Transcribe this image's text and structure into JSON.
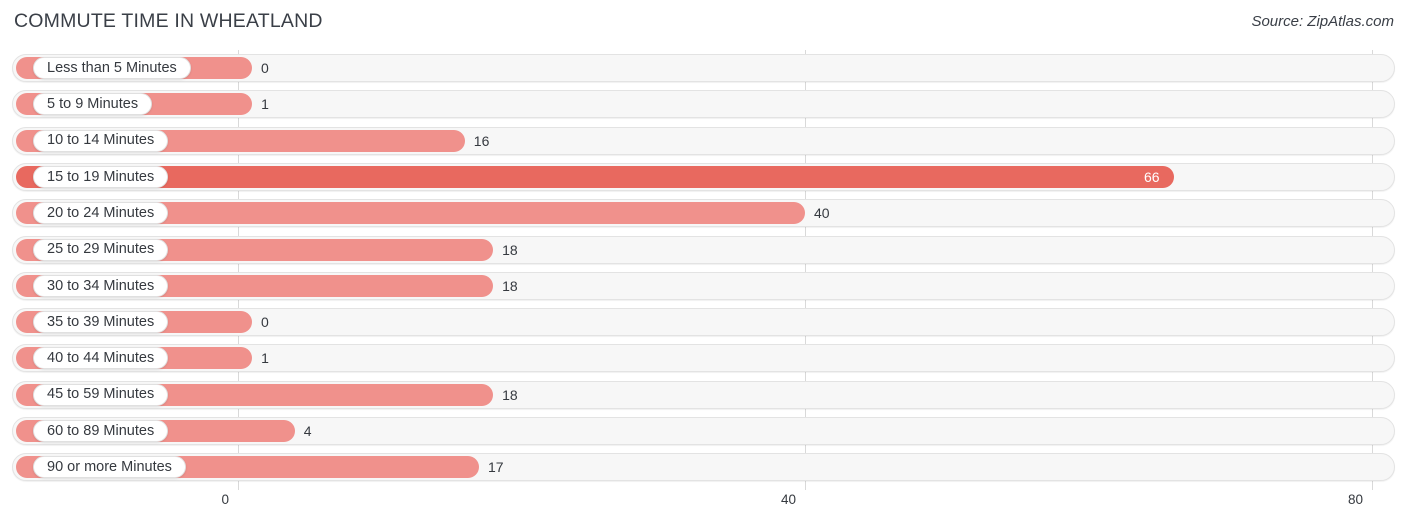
{
  "header": {
    "title": "COMMUTE TIME IN WHEATLAND",
    "source": "Source: ZipAtlas.com"
  },
  "colors": {
    "bar": "#f0918c",
    "bar_highlight": "#e8695f",
    "track": "#f7f7f7",
    "track_border": "#e3e3e3",
    "text": "#35393f",
    "gridline": "#d9d9d9",
    "value_inside": "#ffffff"
  },
  "chart_data": {
    "type": "bar",
    "orientation": "horizontal",
    "title": "COMMUTE TIME IN WHEATLAND",
    "subtitle": "",
    "xlabel": "",
    "ylabel": "",
    "xlim": [
      0,
      80
    ],
    "ticks": [
      0,
      40,
      80
    ],
    "tick_labels": [
      "0",
      "40",
      "80"
    ],
    "grid": true,
    "legend": false,
    "highlight_index": 3,
    "categories": [
      "Less than 5 Minutes",
      "5 to 9 Minutes",
      "10 to 14 Minutes",
      "15 to 19 Minutes",
      "20 to 24 Minutes",
      "25 to 29 Minutes",
      "30 to 34 Minutes",
      "35 to 39 Minutes",
      "40 to 44 Minutes",
      "45 to 59 Minutes",
      "60 to 89 Minutes",
      "90 or more Minutes"
    ],
    "values": [
      0,
      1,
      16,
      66,
      40,
      18,
      18,
      0,
      1,
      18,
      4,
      17
    ],
    "value_labels": [
      "0",
      "1",
      "16",
      "66",
      "40",
      "18",
      "18",
      "0",
      "1",
      "18",
      "4",
      "17"
    ]
  }
}
